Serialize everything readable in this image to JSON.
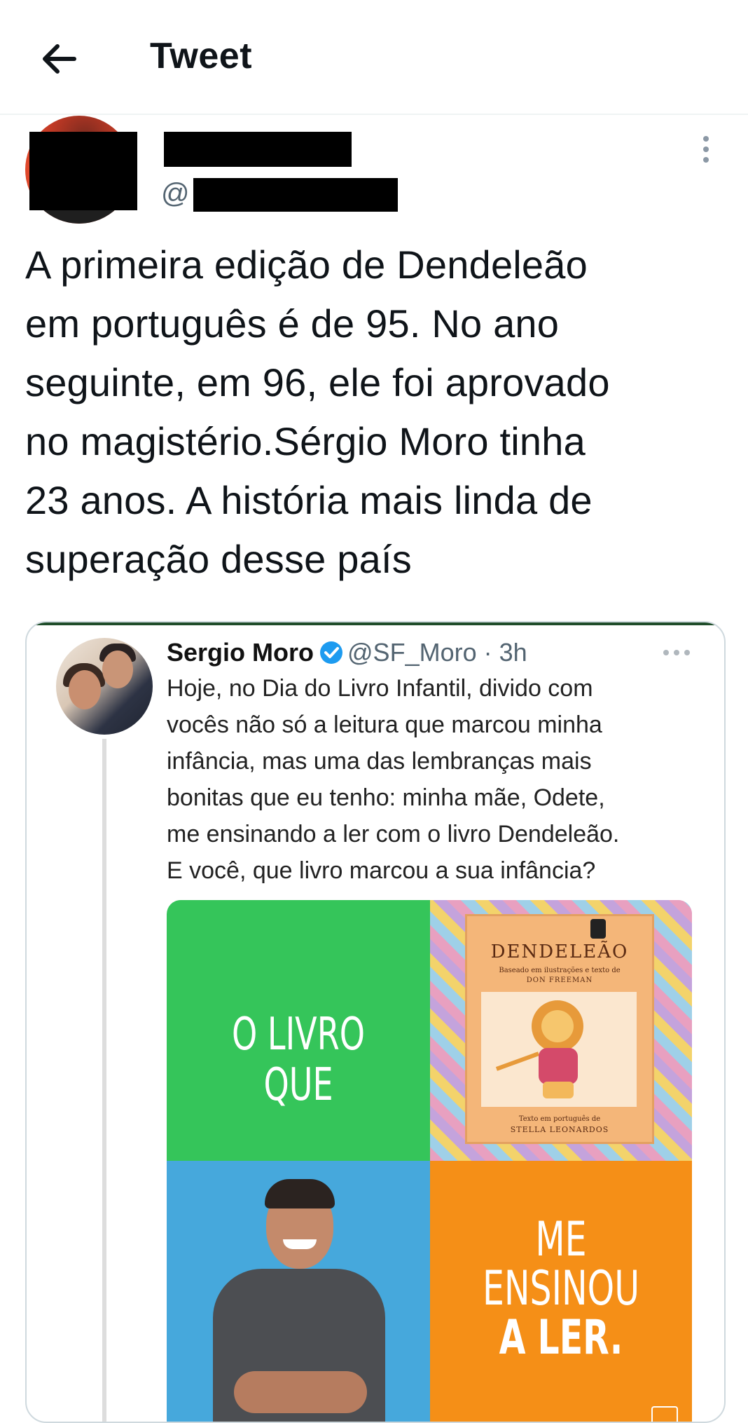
{
  "header": {
    "title": "Tweet",
    "back_icon": "arrow-left-icon"
  },
  "tweet": {
    "handle_prefix": "@",
    "text": "A primeira edição de Dendeleão\nem português é de 95. No ano\nseguinte, em 96, ele foi aprovado\nno magistério.Sérgio Moro tinha\n23 anos. A história mais linda de\nsuperação desse país",
    "more_icon": "more-vertical-icon"
  },
  "quoted": {
    "name": "Sergio Moro",
    "handle_time": "@SF_Moro · 3h",
    "verified_icon": "verified-badge-icon",
    "more_icon": "more-horizontal-icon",
    "text": "Hoje, no Dia do Livro Infantil, divido com\nvocês não só a leitura que marcou minha\ninfância, mas uma das lembranças mais\nbonitas que eu tenho: minha mãe, Odete,\nme ensinando a ler com o livro Dendeleão.\nE você, que livro marcou a sua infância?",
    "collage": {
      "green_label": "O LIVRO QUE",
      "orange_line1": "ME",
      "orange_line2": "ENSINOU",
      "orange_line3": "A LER.",
      "book": {
        "title": "DENDELEÃO",
        "subtitle": "Baseado em ilustrações e texto de",
        "author": "DON FREEMAN",
        "bottom_text": "Texto em português de",
        "translator": "STELLA LEONARDOS"
      }
    }
  },
  "colors": {
    "green": "#35c55a",
    "blue": "#46a8dc",
    "orange": "#f58f17",
    "verified": "#1d9bf0"
  }
}
